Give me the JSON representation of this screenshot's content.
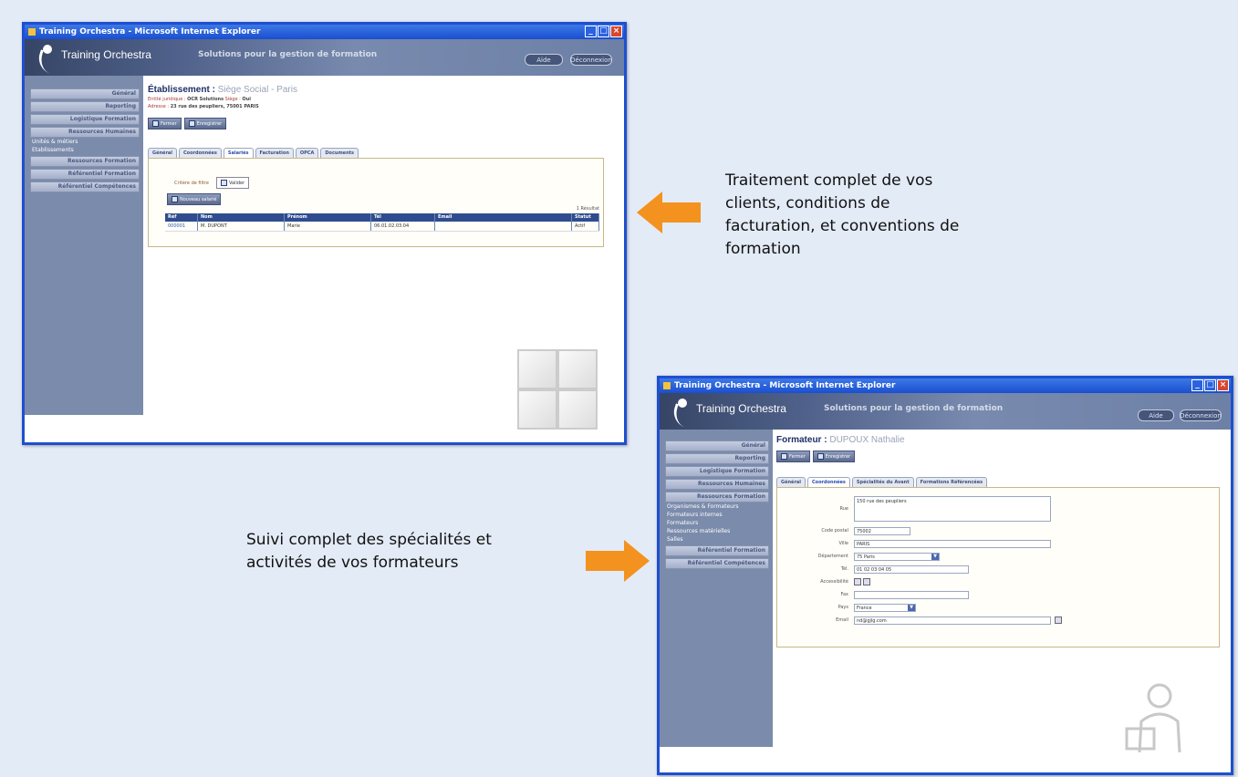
{
  "colors": {
    "arrow": "#f3921e",
    "window_border": "#1f4fd0",
    "sidebar": "#7b8bab",
    "grid_header": "#2f4d8e"
  },
  "window1": {
    "title": "Training Orchestra - Microsoft Internet Explorer",
    "logo": "Training Orchestra",
    "slogan": "Solutions pour la gestion de formation",
    "header_buttons": [
      "Aide",
      "Déconnexion"
    ],
    "nav": [
      "Général",
      "Reporting",
      "Logistique Formation",
      "Ressources Humaines"
    ],
    "nav_subs": [
      "Unités & métiers",
      "Établissements"
    ],
    "nav_more": [
      "Ressources Formation",
      "Référentiel Formation",
      "Référentiel Compétences"
    ],
    "page_title": "Établissement :",
    "page_subtitle": "Siège Social - Paris",
    "meta_label1": "Entité juridique :",
    "meta_value1": "OCR Solutions",
    "meta_label2": "Siège :",
    "meta_value2": "Oui",
    "meta_label3": "Adresse :",
    "meta_value3": "23 rue des peupliers, 75001 PARIS",
    "buttons": [
      "Fermer",
      "Enregistrer"
    ],
    "tabs": [
      "Général",
      "Coordonnées",
      "Salariés",
      "Facturation",
      "OPCA",
      "Documents"
    ],
    "filter_label": "Critère de filtre",
    "filter_button": "Valider",
    "action_button": "Nouveau salarié",
    "record_count": "1 Résultat",
    "grid_headers": [
      "Réf",
      "Nom",
      "Prénom",
      "Tél",
      "Email",
      "Statut"
    ],
    "grid_rows": [
      [
        "000001",
        "M. DUPONT",
        "Marie",
        "06.01.02.03.04",
        "",
        "Actif"
      ]
    ]
  },
  "window2": {
    "title": "Training Orchestra - Microsoft Internet Explorer",
    "logo": "Training Orchestra",
    "slogan": "Solutions pour la gestion de formation",
    "header_buttons": [
      "Aide",
      "Déconnexion"
    ],
    "nav": [
      "Général",
      "Reporting",
      "Logistique Formation",
      "Ressources Humaines",
      "Ressources Formation"
    ],
    "nav_subs": [
      "Organismes & Formateurs",
      "Formateurs internes",
      "Formateurs",
      "Ressources matérielles",
      "Salles"
    ],
    "nav_more": [
      "Référentiel Formation",
      "Référentiel Compétences"
    ],
    "page_title": "Formateur :",
    "page_subtitle": "DUPOUX Nathalie",
    "buttons": [
      "Fermer",
      "Enregistrer"
    ],
    "tabs": [
      "Général",
      "Coordonnées",
      "Spécialités du Avant",
      "Formations Référencées"
    ],
    "form": [
      {
        "label": "Rue",
        "value": "150 rue des peupliers",
        "kind": "textarea"
      },
      {
        "label": "Code postal",
        "value": "75002",
        "kind": "short"
      },
      {
        "label": "Ville",
        "value": "PARIS",
        "kind": "long"
      },
      {
        "label": "Département",
        "value": "75 Paris",
        "kind": "select"
      },
      {
        "label": "Tél.",
        "value": "01 02 03 04 05",
        "kind": "medium"
      },
      {
        "label": "Accessibilité",
        "value": "",
        "kind": "icons"
      },
      {
        "label": "Fax",
        "value": "",
        "kind": "medium"
      },
      {
        "label": "Pays",
        "value": "France",
        "kind": "select"
      },
      {
        "label": "Email",
        "value": "nd@gjlg.com",
        "kind": "long"
      }
    ]
  },
  "callout1": [
    "Traitement complet de vos",
    "clients, conditions de",
    "facturation, et conventions de",
    "formation"
  ],
  "callout2": [
    "Suivi complet des spécialités et",
    "activités de vos formateurs"
  ]
}
